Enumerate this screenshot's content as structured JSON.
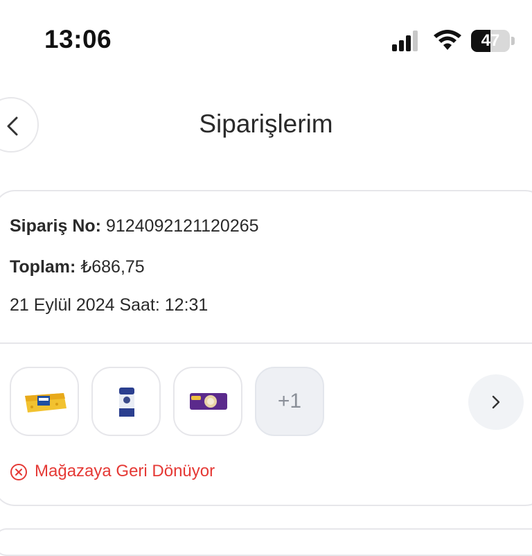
{
  "status_bar": {
    "time": "13:06",
    "battery_percent": "47",
    "battery_level": 0.47
  },
  "header": {
    "title": "Siparişlerim"
  },
  "order": {
    "order_no_label": "Sipariş No:",
    "order_no_value": "9124092121120265",
    "total_label": "Toplam:",
    "total_value": "₺686,75",
    "date_text": "21 Eylül 2024 Saat: 12:31",
    "more_items": "+1",
    "status_text": "Mağazaya Geri Dönüyor",
    "status_color": "#e53935"
  },
  "colors": {
    "border": "#e6e6ea",
    "accent_red": "#e53935",
    "muted_bg": "#eef0f4"
  }
}
